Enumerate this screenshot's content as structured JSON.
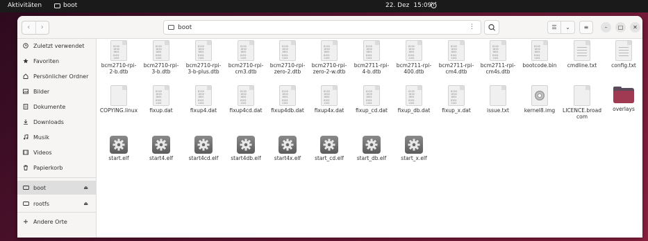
{
  "topbar": {
    "activities": "Aktivitäten",
    "app_name": "boot",
    "date": "22. Dez",
    "time": "15:09"
  },
  "headerbar": {
    "path": "boot"
  },
  "sidebar": {
    "items": [
      {
        "label": "Zuletzt verwendet",
        "icon": "clock-icon"
      },
      {
        "label": "Favoriten",
        "icon": "star-icon"
      },
      {
        "label": "Persönlicher Ordner",
        "icon": "home-icon"
      },
      {
        "label": "Bilder",
        "icon": "image-icon"
      },
      {
        "label": "Dokumente",
        "icon": "document-icon"
      },
      {
        "label": "Downloads",
        "icon": "download-icon"
      },
      {
        "label": "Musik",
        "icon": "music-icon"
      },
      {
        "label": "Videos",
        "icon": "video-icon"
      },
      {
        "label": "Papierkorb",
        "icon": "trash-icon"
      }
    ],
    "devices": [
      {
        "label": "boot",
        "icon": "drive-icon",
        "active": true
      },
      {
        "label": "rootfs",
        "icon": "drive-icon",
        "active": false
      }
    ],
    "other": {
      "label": "Andere Orte",
      "icon": "plus-icon"
    }
  },
  "files": [
    {
      "name": "bcm2710-rpi-2-b.dtb",
      "kind": "binary"
    },
    {
      "name": "bcm2710-rpi-3-b.dtb",
      "kind": "binary"
    },
    {
      "name": "bcm2710-rpi-3-b-plus.dtb",
      "kind": "binary"
    },
    {
      "name": "bcm2710-rpi-cm3.dtb",
      "kind": "binary"
    },
    {
      "name": "bcm2710-rpi-zero-2.dtb",
      "kind": "binary"
    },
    {
      "name": "bcm2710-rpi-zero-2-w.dtb",
      "kind": "binary"
    },
    {
      "name": "bcm2711-rpi-4-b.dtb",
      "kind": "binary"
    },
    {
      "name": "bcm2711-rpi-400.dtb",
      "kind": "binary"
    },
    {
      "name": "bcm2711-rpi-cm4.dtb",
      "kind": "binary"
    },
    {
      "name": "bcm2711-rpi-cm4s.dtb",
      "kind": "binary"
    },
    {
      "name": "bootcode.bin",
      "kind": "binary"
    },
    {
      "name": "cmdline.txt",
      "kind": "text"
    },
    {
      "name": "config.txt",
      "kind": "text"
    },
    {
      "name": "COPYING.linux",
      "kind": "blank"
    },
    {
      "name": "fixup.dat",
      "kind": "binary"
    },
    {
      "name": "fixup4.dat",
      "kind": "binary"
    },
    {
      "name": "fixup4cd.dat",
      "kind": "binary"
    },
    {
      "name": "fixup4db.dat",
      "kind": "binary"
    },
    {
      "name": "fixup4x.dat",
      "kind": "binary"
    },
    {
      "name": "fixup_cd.dat",
      "kind": "binary"
    },
    {
      "name": "fixup_db.dat",
      "kind": "binary"
    },
    {
      "name": "fixup_x.dat",
      "kind": "binary"
    },
    {
      "name": "issue.txt",
      "kind": "blank"
    },
    {
      "name": "kernel8.img",
      "kind": "disc"
    },
    {
      "name": "LICENCE.broadcom",
      "kind": "blank"
    },
    {
      "name": "overlays",
      "kind": "folder"
    },
    {
      "name": "start.elf",
      "kind": "exec"
    },
    {
      "name": "start4.elf",
      "kind": "exec"
    },
    {
      "name": "start4cd.elf",
      "kind": "exec"
    },
    {
      "name": "start4db.elf",
      "kind": "exec"
    },
    {
      "name": "start4x.elf",
      "kind": "exec"
    },
    {
      "name": "start_cd.elf",
      "kind": "exec"
    },
    {
      "name": "start_db.elf",
      "kind": "exec"
    },
    {
      "name": "start_x.elf",
      "kind": "exec"
    }
  ]
}
